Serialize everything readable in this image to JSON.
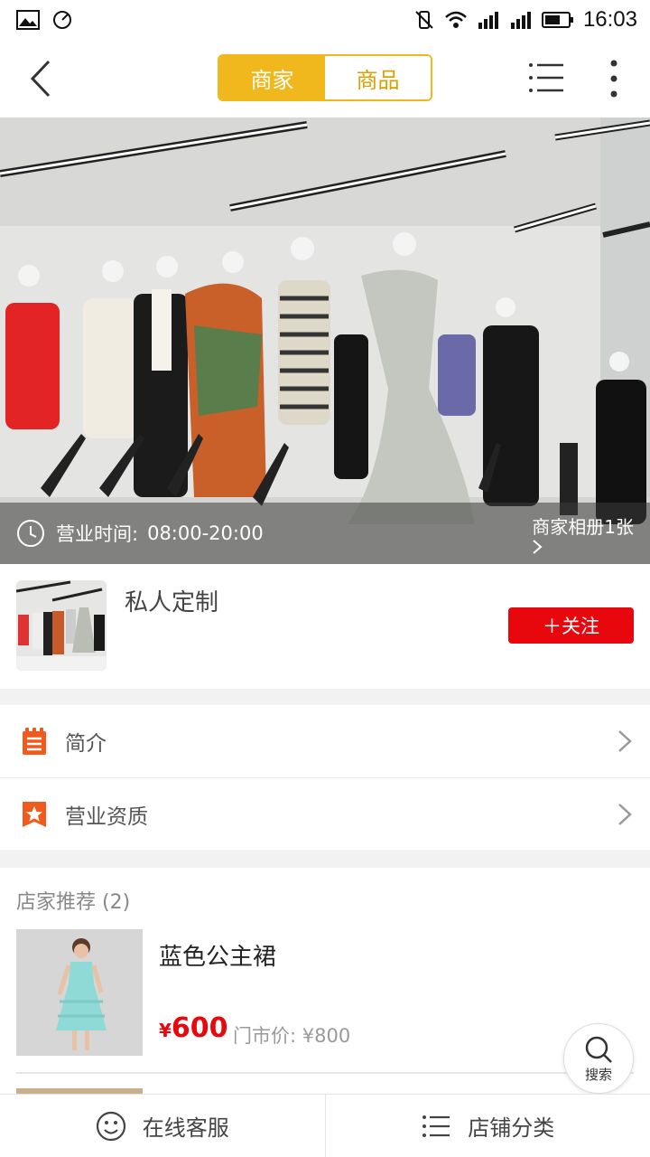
{
  "status_bar": {
    "time": "16:03"
  },
  "nav": {
    "tabs": [
      {
        "label": "商家",
        "active": true
      },
      {
        "label": "商品",
        "active": false
      }
    ]
  },
  "hero": {
    "hours_label": "营业时间:",
    "hours_value": "08:00-20:00",
    "album_label": "商家相册1张"
  },
  "merchant": {
    "name": "私人定制",
    "follow_label": "＋关注"
  },
  "rows": [
    {
      "label": "简介",
      "icon": "notepad-icon"
    },
    {
      "label": "营业资质",
      "icon": "star-badge-icon"
    }
  ],
  "recommend": {
    "title": "店家推荐 (2)",
    "products": [
      {
        "name": "蓝色公主裙",
        "currency": "¥",
        "price": "600",
        "market_price": "门市价: ¥800"
      }
    ]
  },
  "search_fab": {
    "label": "搜索"
  },
  "bottom_bar": {
    "service_label": "在线客服",
    "category_label": "店铺分类"
  },
  "colors": {
    "accent_yellow": "#f0b81c",
    "brand_red": "#e8070d",
    "icon_orange": "#f25a1d"
  }
}
